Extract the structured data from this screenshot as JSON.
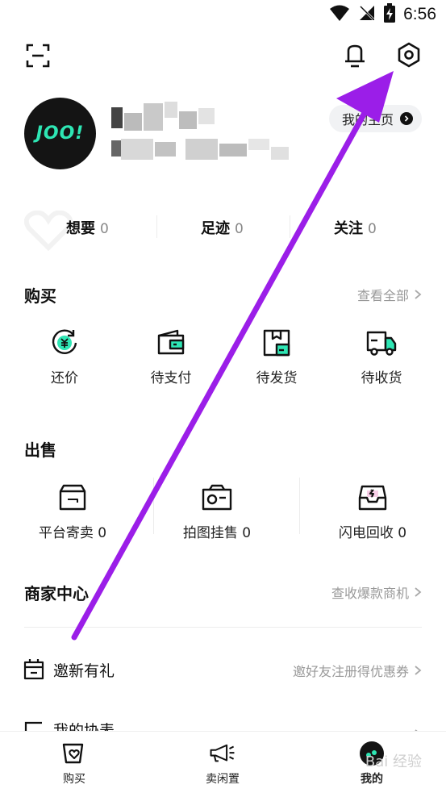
{
  "status_bar": {
    "time": "6:56"
  },
  "profile": {
    "avatar_text": "JOO!",
    "homepage_label": "我的主页"
  },
  "stats": [
    {
      "label": "想要",
      "count": "0"
    },
    {
      "label": "足迹",
      "count": "0"
    },
    {
      "label": "关注",
      "count": "0"
    }
  ],
  "buy": {
    "title": "购买",
    "link": "查看全部",
    "items": [
      {
        "label": "还价",
        "icon": "bargain-icon"
      },
      {
        "label": "待支付",
        "icon": "wallet-icon"
      },
      {
        "label": "待发货",
        "icon": "box-icon"
      },
      {
        "label": "待收货",
        "icon": "truck-icon"
      }
    ]
  },
  "sell": {
    "title": "出售",
    "items": [
      {
        "label": "平台寄卖 0",
        "icon": "package-icon"
      },
      {
        "label": "拍图挂售 0",
        "icon": "camera-icon"
      },
      {
        "label": "闪电回收 0",
        "icon": "lightning-tray-icon"
      }
    ]
  },
  "merchant": {
    "title": "商家中心",
    "link": "查收爆款商机"
  },
  "invite": {
    "title": "邀新有礼",
    "desc": "邀好友注册得优惠券"
  },
  "partial_row": {
    "title": "我的协表"
  },
  "bottom_nav": [
    {
      "label": "购买"
    },
    {
      "label": "卖闲置"
    },
    {
      "label": "我的"
    }
  ],
  "watermark": "Bai 经验",
  "colors": {
    "accent": "#2ee6b4",
    "annotation": "#9b1ee8"
  }
}
